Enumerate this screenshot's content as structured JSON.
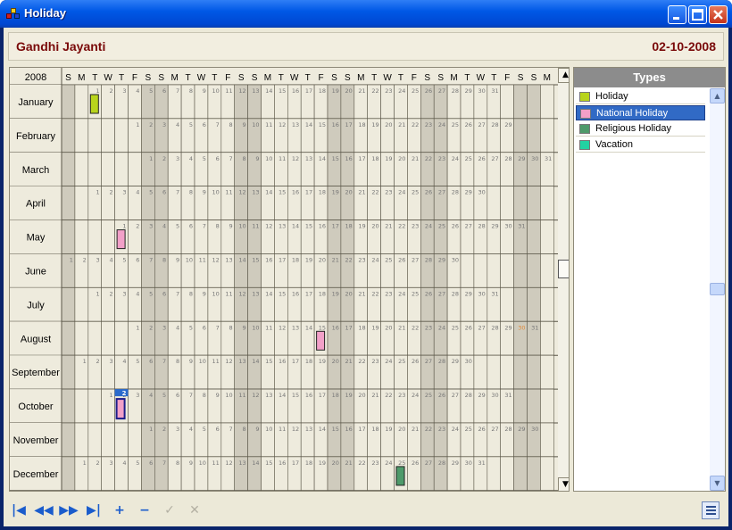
{
  "window": {
    "title": "Holiday"
  },
  "header": {
    "name": "Gandhi Jayanti",
    "date": "02-10-2008"
  },
  "calendar": {
    "year": "2008",
    "weekday_letters": [
      "S",
      "M",
      "T",
      "W",
      "T",
      "F",
      "S",
      "S",
      "M",
      "T",
      "W",
      "T",
      "F",
      "S",
      "S",
      "M",
      "T",
      "W",
      "T",
      "F",
      "S",
      "S",
      "M",
      "T",
      "W",
      "T",
      "F",
      "S",
      "S",
      "M",
      "T",
      "W",
      "T",
      "F",
      "S",
      "S",
      "M"
    ],
    "months": [
      {
        "name": "January",
        "start": 2,
        "days": 31
      },
      {
        "name": "February",
        "start": 5,
        "days": 29
      },
      {
        "name": "March",
        "start": 6,
        "days": 31
      },
      {
        "name": "April",
        "start": 2,
        "days": 30
      },
      {
        "name": "May",
        "start": 4,
        "days": 31
      },
      {
        "name": "June",
        "start": 0,
        "days": 30
      },
      {
        "name": "July",
        "start": 2,
        "days": 31
      },
      {
        "name": "August",
        "start": 5,
        "days": 31
      },
      {
        "name": "September",
        "start": 1,
        "days": 30
      },
      {
        "name": "October",
        "start": 3,
        "days": 31
      },
      {
        "name": "November",
        "start": 6,
        "days": 30
      },
      {
        "name": "December",
        "start": 1,
        "days": 31
      }
    ],
    "events": [
      {
        "month": 0,
        "day": 1,
        "type": "Holiday"
      },
      {
        "month": 4,
        "day": 1,
        "type": "National Holiday"
      },
      {
        "month": 7,
        "day": 15,
        "type": "National Holiday"
      },
      {
        "month": 9,
        "day": 2,
        "type": "National Holiday",
        "selected": true
      },
      {
        "month": 11,
        "day": 25,
        "type": "Religious Holiday"
      }
    ],
    "highlight_day": {
      "month": 7,
      "day": 30
    }
  },
  "types": {
    "header": "Types",
    "items": [
      {
        "label": "Holiday",
        "color": "#b8d41c",
        "selected": false
      },
      {
        "label": "National Holiday",
        "color": "#f2a0c8",
        "selected": true
      },
      {
        "label": "Religious Holiday",
        "color": "#4e9a6a",
        "selected": false
      },
      {
        "label": "Vacation",
        "color": "#22d2a2",
        "selected": false
      }
    ]
  },
  "navigator": {
    "buttons": [
      {
        "name": "first-record-button",
        "icon": "first-icon",
        "glyph": "|◀",
        "enabled": true
      },
      {
        "name": "prior-record-button",
        "icon": "prior-icon",
        "glyph": "◀◀",
        "enabled": true
      },
      {
        "name": "next-record-button",
        "icon": "next-icon",
        "glyph": "▶▶",
        "enabled": true
      },
      {
        "name": "last-record-button",
        "icon": "last-icon",
        "glyph": "▶|",
        "enabled": true
      },
      {
        "name": "insert-record-button",
        "icon": "plus-icon",
        "glyph": "+",
        "enabled": true
      },
      {
        "name": "delete-record-button",
        "icon": "minus-icon",
        "glyph": "−",
        "enabled": true
      },
      {
        "name": "post-record-button",
        "icon": "check-icon",
        "glyph": "✓",
        "enabled": false
      },
      {
        "name": "cancel-record-button",
        "icon": "x-icon",
        "glyph": "✕",
        "enabled": false
      }
    ]
  },
  "colors": {
    "accent": "#316ac5",
    "title_text": "#7a0a0a",
    "weekend_shade": "#cfcbbd",
    "selected_cell": "#2a6acc"
  }
}
